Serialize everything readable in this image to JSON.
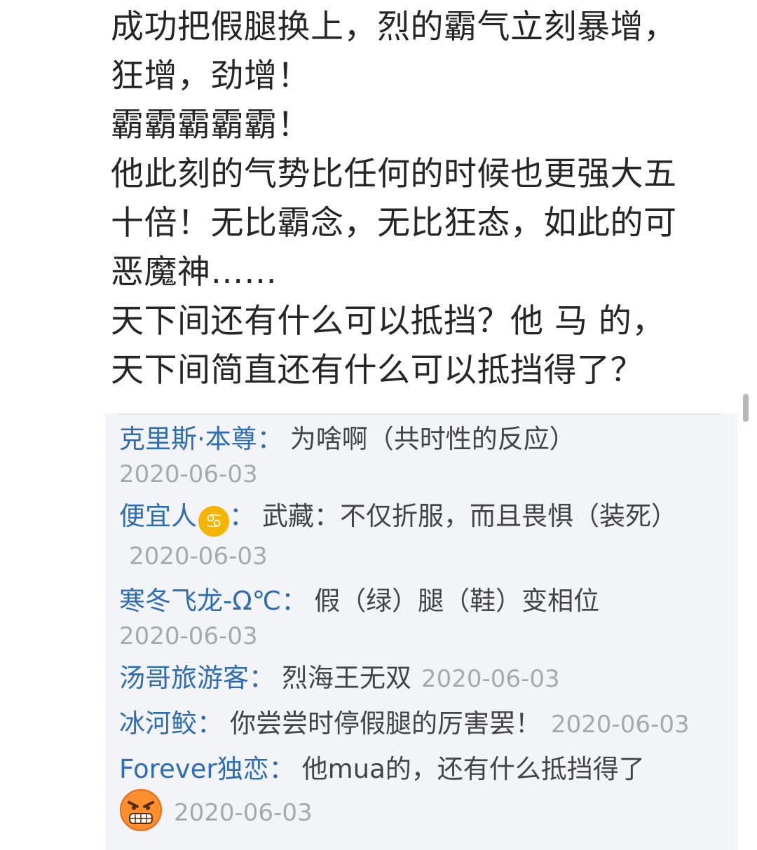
{
  "post": {
    "lines": [
      "成功把假腿换上，烈的霸气立刻暴增，",
      "狂增，劲增！",
      "霸霸霸霸霸！",
      "他此刻的气势比任何的时候也更强大五",
      "十倍！无比霸念，无比狂态，如此的可",
      "恶魔神……",
      "天下间还有什么可以抵挡？他 马 的，",
      "天下间简直还有什么可以抵挡得了？"
    ]
  },
  "comments": [
    {
      "user": "克里斯·本尊",
      "separator": "：",
      "text": "为啥啊（共时性的反应）",
      "date": "2020-06-03"
    },
    {
      "user": "便宜人",
      "user_icon": "cancer-zodiac-icon",
      "user_icon_glyph": "♋",
      "separator": "：",
      "text": "武藏：不仅折服，而且畏惧（装死）",
      "date": "2020-06-03"
    },
    {
      "user": "寒冬飞龙-Ω℃",
      "separator": "：",
      "text": "假（绿）腿（鞋）变相位",
      "date": "2020-06-03"
    },
    {
      "user": "汤哥旅游客",
      "separator": "：",
      "text": "烈海王无双",
      "date": "2020-06-03"
    },
    {
      "user": "冰河鲛",
      "separator": "：",
      "text": "你尝尝时停假腿的厉害罢！",
      "date": "2020-06-03"
    },
    {
      "user": "Forever独恋",
      "separator": "：",
      "text": "他mua的，还有什么抵挡得了",
      "text_icon": "angry-face-icon",
      "date": "2020-06-03"
    }
  ],
  "colors": {
    "username": "#2e6db3",
    "date": "#a8a9ad",
    "comment_bg": "#f3f4f8"
  }
}
